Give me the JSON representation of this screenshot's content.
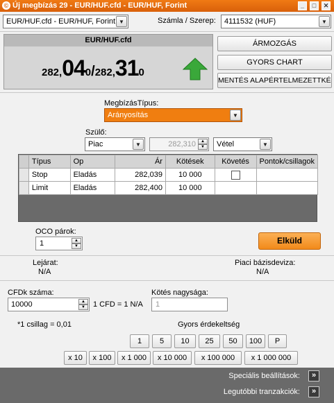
{
  "window": {
    "title": "Új megbízás 29 - EUR/HUF.cfd - EUR/HUF, Forint",
    "logo_glyph": "©",
    "min_glyph": "_",
    "max_glyph": "□",
    "close_glyph": "✕"
  },
  "instrument_select": {
    "value": "EUR/HUF.cfd - EUR/HUF, Forint"
  },
  "account": {
    "label": "Számla / Szerep:",
    "value": "4111532 (HUF)"
  },
  "quote": {
    "symbol": "EUR/HUF.cfd",
    "bid_small": "282,",
    "bid_big": "04",
    "bid_tail": "0",
    "sep": "/",
    "ask_small": "282,",
    "ask_big": "31",
    "ask_tail": "0",
    "trend": "up"
  },
  "side_buttons": {
    "price_movement": "ÁRMOZGÁS",
    "quick_chart": "GYORS CHART",
    "save_default": "MENTÉS ALAPÉRTELMEZETTKÉNT"
  },
  "order_type": {
    "label": "MegbízásTípus:",
    "value": "Arányosítás"
  },
  "parent": {
    "label": "Szülő:",
    "type_value": "Piac",
    "price_placeholder": "282,310",
    "side_value": "Vétel"
  },
  "legs_table": {
    "headers": [
      "Típus",
      "Op",
      "Ár",
      "Kötések",
      "Követés",
      "Pontok/csillagok"
    ],
    "rows": [
      {
        "type": "Stop",
        "op": "Eladás",
        "price": "282,039",
        "qty": "10 000",
        "trailing": false,
        "points": ""
      },
      {
        "type": "Limit",
        "op": "Eladás",
        "price": "282,400",
        "qty": "10 000",
        "points": ""
      }
    ]
  },
  "oco": {
    "label": "OCO párok:",
    "value": "1"
  },
  "submit_label": "Elküld",
  "expiry": {
    "label": "Lejárat:",
    "value": "N/A"
  },
  "base_currency": {
    "label": "Piaci bázisdeviza:",
    "value": "N/A"
  },
  "cfd_count": {
    "label": "CFDk száma:",
    "value": "10000",
    "ratio": "1 CFD = 1 N/A"
  },
  "trade_size": {
    "label": "Kötés nagysága:",
    "placeholder": "1"
  },
  "star_note": "*1 csillag = 0,01",
  "quick_interest": {
    "label": "Gyors érdekeltség",
    "row1": [
      "1",
      "5",
      "10",
      "25",
      "50",
      "100",
      "P"
    ],
    "row2": [
      "x 10",
      "x 100",
      "x 1 000",
      "x 10 000",
      "x 100 000",
      "x 1 000 000"
    ]
  },
  "footer": {
    "special_settings": "Speciális beállítások:",
    "recent_trades": "Legutóbbi tranzakciók:",
    "expand_glyph": "»"
  },
  "colors": {
    "title_orange": "#e8700f",
    "order_type_orange": "#f07e10",
    "submit_orange": "#f89a30",
    "arrow_green": "#3aa83a",
    "footer_gray": "#6a6a6a"
  }
}
